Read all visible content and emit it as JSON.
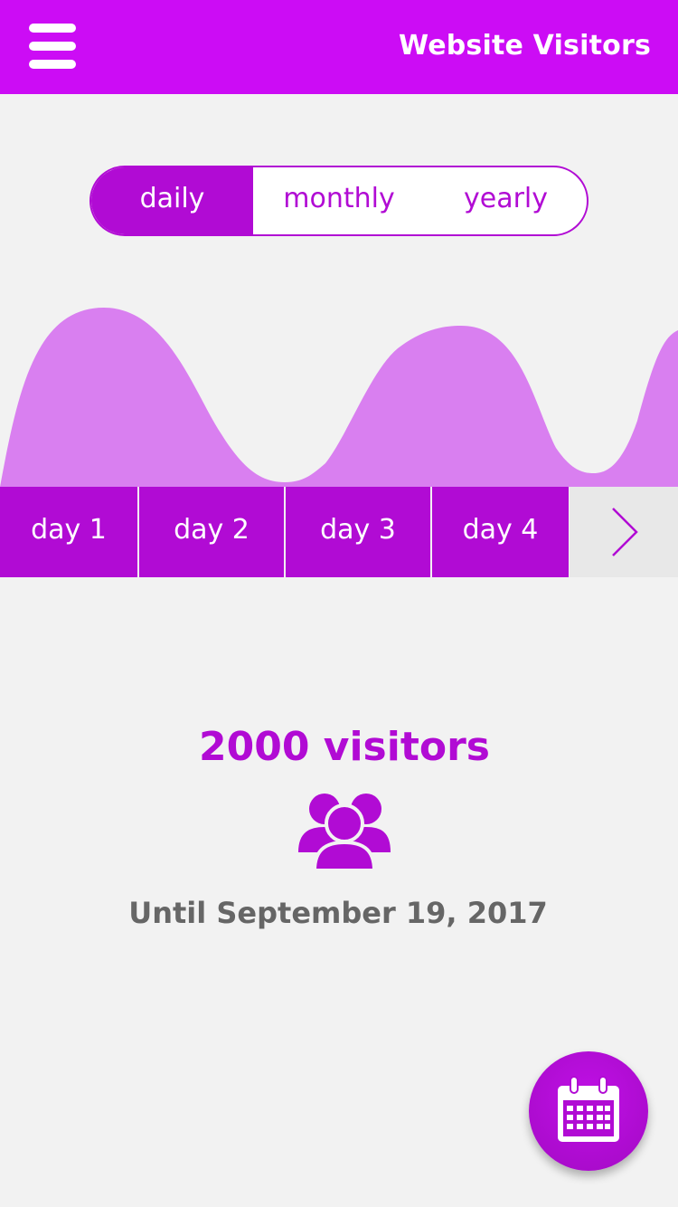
{
  "header": {
    "title": "Website Visitors",
    "menu_icon": "hamburger-menu-icon"
  },
  "period_tabs": [
    {
      "label": "daily",
      "active": true
    },
    {
      "label": "monthly",
      "active": false
    },
    {
      "label": "yearly",
      "active": false
    }
  ],
  "day_tabs": [
    "day 1",
    "day 2",
    "day 3",
    "day 4"
  ],
  "next_icon": "chevron-right-icon",
  "stats": {
    "visitors": "2000 visitors",
    "icon": "users-group-icon",
    "until": "Until September 19, 2017"
  },
  "fab_icon": "calendar-icon",
  "colors": {
    "header": "#cc0cf5",
    "accent": "#b10bd4",
    "chart_fill": "#d97ff0",
    "text_gray": "#666666",
    "background": "#f2f2f2"
  }
}
